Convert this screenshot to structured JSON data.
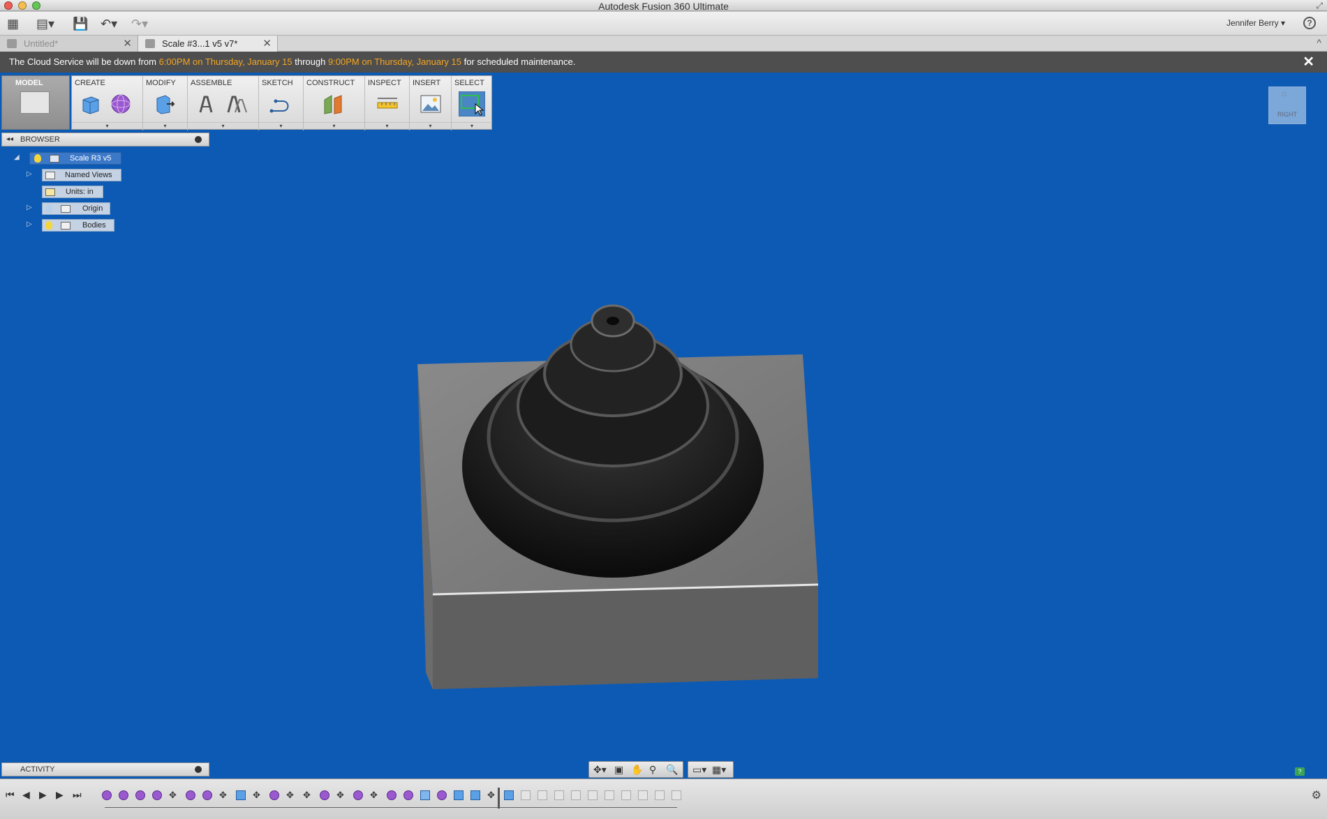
{
  "window": {
    "title": "Autodesk Fusion 360 Ultimate"
  },
  "toolbar": {
    "user_name": "Jennifer Berry",
    "help": "?"
  },
  "tabs": [
    {
      "label": "Untitled*",
      "active": false
    },
    {
      "label": "Scale #3...1 v5 v7*",
      "active": true
    }
  ],
  "banner": {
    "prefix": "The Cloud Service will be down from ",
    "start_time": "6:00PM on Thursday, January 15",
    "middle": " through ",
    "end_time": "9:00PM on Thursday, January 15",
    "suffix": " for scheduled maintenance.",
    "highlight_color": "#f5a623"
  },
  "ribbon": {
    "workspace": "MODEL",
    "groups": [
      "CREATE",
      "MODIFY",
      "ASSEMBLE",
      "SKETCH",
      "CONSTRUCT",
      "INSPECT",
      "INSERT",
      "SELECT"
    ]
  },
  "browser": {
    "title": "BROWSER",
    "root": "Scale R3 v5",
    "items": [
      {
        "label": "Named Views"
      },
      {
        "label": "Units: in"
      },
      {
        "label": "Origin"
      },
      {
        "label": "Bodies"
      }
    ]
  },
  "viewcube": {
    "face": "RIGHT"
  },
  "activity": {
    "title": "ACTIVITY"
  },
  "colors": {
    "viewport": "#0d5ab4",
    "accent": "#3c78c8"
  }
}
